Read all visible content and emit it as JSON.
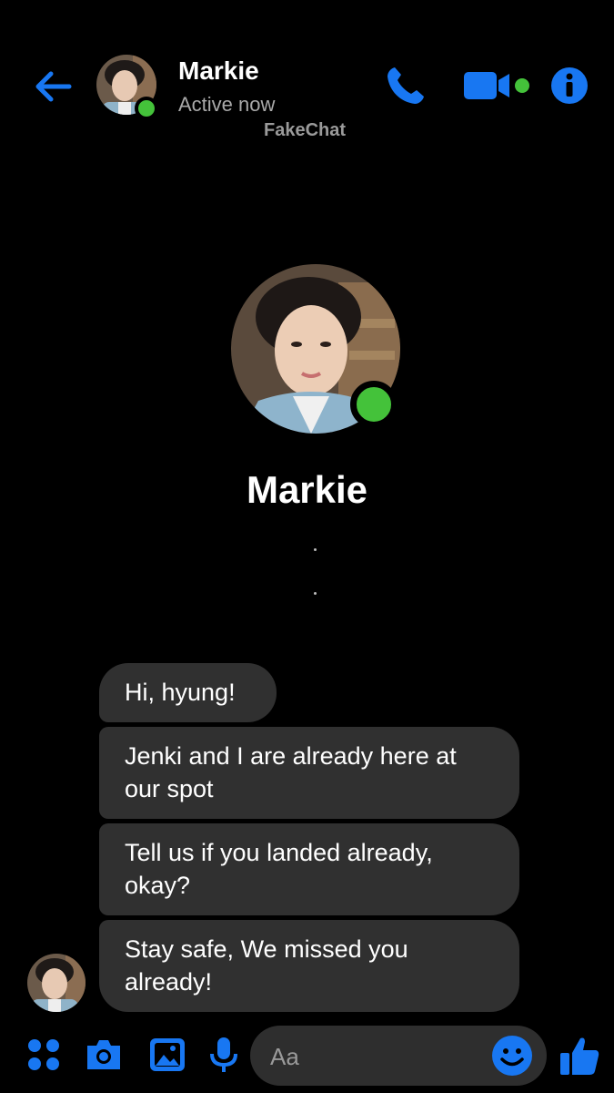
{
  "header": {
    "contact_name": "Markie",
    "status": "Active now",
    "watermark": "FakeChat",
    "icons": [
      "back-arrow-icon",
      "phone-icon",
      "video-camera-icon",
      "info-icon"
    ],
    "accent_color": "#1877f2",
    "online_color": "#44c23a"
  },
  "profile": {
    "name": "Markie"
  },
  "messages": [
    {
      "text": "Hi, hyung!"
    },
    {
      "text": "Jenki and I are already here at our spot"
    },
    {
      "text": "Tell us if you landed already, okay?"
    },
    {
      "text": "Stay safe, We missed you already!"
    }
  ],
  "composer": {
    "placeholder": "Aa",
    "icons": [
      "apps-grid-icon",
      "camera-icon",
      "gallery-icon",
      "microphone-icon",
      "emoji-icon",
      "thumbs-up-icon"
    ]
  }
}
